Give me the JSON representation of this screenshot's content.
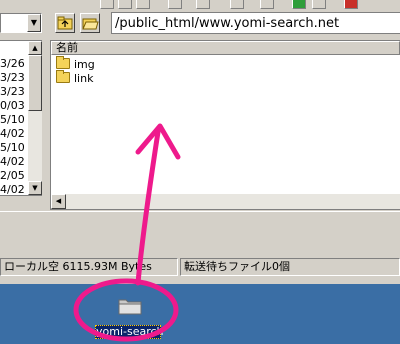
{
  "address_bar": {
    "path": "/public_html/www.yomi-search.net"
  },
  "left_panel": {
    "dates": [
      "3/26",
      "3/23",
      "3/23",
      "0/03",
      "5/10",
      "4/02",
      "5/10",
      "4/02",
      "2/05",
      "4/02"
    ]
  },
  "file_list": {
    "column_header": "名前",
    "items": [
      {
        "name": "img",
        "icon": "folder-icon"
      },
      {
        "name": "link",
        "icon": "folder-icon"
      }
    ]
  },
  "status_bar": {
    "local_space": "ローカル空 6115.93M Bytes",
    "transfer_queue": "転送待ちファイル0個"
  },
  "desktop": {
    "folder_label": "yomi-search"
  },
  "colors": {
    "desktop": "#3a6ea5",
    "annotation": "#ee1a8c",
    "selection": "#0a246a"
  }
}
